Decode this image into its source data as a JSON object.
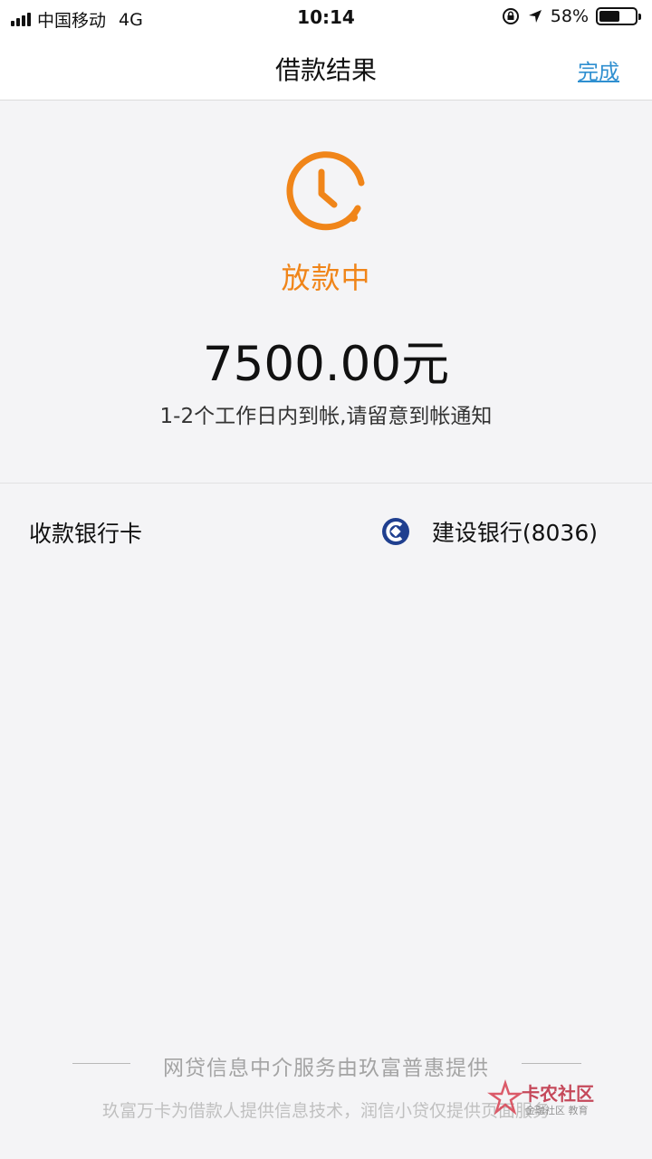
{
  "status_bar": {
    "carrier": "中国移动",
    "network": "4G",
    "time": "10:14",
    "battery_text": "58%",
    "battery_level": 0.58
  },
  "nav": {
    "title": "借款结果",
    "done_label": "完成"
  },
  "result": {
    "status": "放款中",
    "amount": "7500.00元",
    "note": "1-2个工作日内到帐,请留意到帐通知",
    "status_color": "#f08519"
  },
  "bank": {
    "label": "收款银行卡",
    "name": "建设银行(8036)",
    "logo_icon": "ccb-bank-icon",
    "logo_color": "#1f3f8f"
  },
  "footer": {
    "main": "网贷信息中介服务由玖富普惠提供",
    "sub": "玖富万卡为借款人提供信息技术，润信小贷仅提供页面服务"
  },
  "watermark": {
    "main": "卡农社区",
    "sub": "金融社区 教育"
  },
  "colors": {
    "accent": "#f08519",
    "link": "#2f8fd0",
    "background": "#f4f4f6"
  }
}
